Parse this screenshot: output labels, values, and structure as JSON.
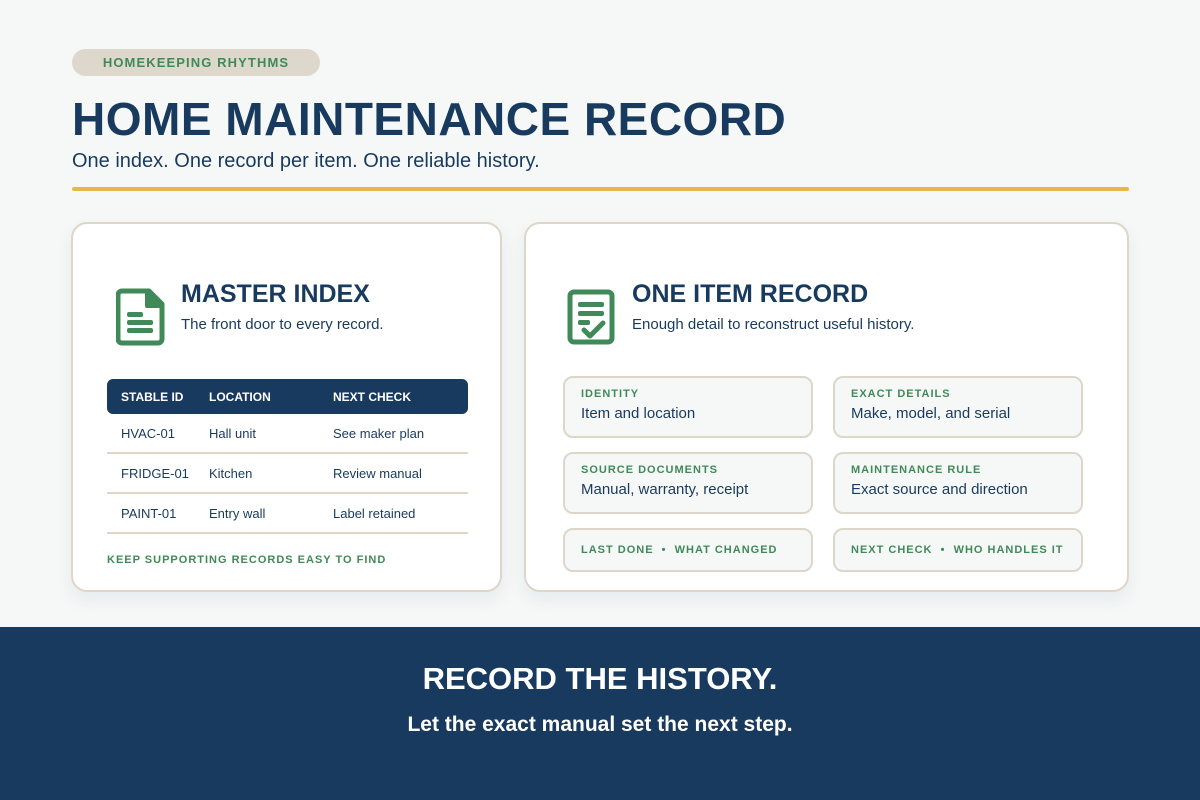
{
  "header": {
    "eyebrow": "HOMEKEEPING RHYTHMS",
    "title": "HOME MAINTENANCE RECORD",
    "subtitle": "One index. One record per item. One reliable history."
  },
  "master_index": {
    "icon": "document-icon",
    "title": "MASTER INDEX",
    "subtitle": "The front door to every record.",
    "columns": [
      "STABLE ID",
      "LOCATION",
      "NEXT CHECK"
    ],
    "rows": [
      [
        "HVAC-01",
        "Hall unit",
        "See maker plan"
      ],
      [
        "FRIDGE-01",
        "Kitchen",
        "Review manual"
      ],
      [
        "PAINT-01",
        "Entry wall",
        "Label retained"
      ]
    ],
    "footnote": "KEEP SUPPORTING RECORDS EASY TO FIND"
  },
  "item_record": {
    "icon": "checklist-icon",
    "title": "ONE ITEM RECORD",
    "subtitle": "Enough detail to reconstruct useful history.",
    "fields": [
      {
        "label": "IDENTITY",
        "value": "Item and location"
      },
      {
        "label": "EXACT DETAILS",
        "value": "Make, model, and serial"
      },
      {
        "label": "SOURCE DOCUMENTS",
        "value": "Manual, warranty, receipt"
      },
      {
        "label": "MAINTENANCE RULE",
        "value": "Exact source and direction"
      },
      {
        "label": "LAST DONE  •  WHAT CHANGED"
      },
      {
        "label": "NEXT CHECK  •  WHO HANDLES IT"
      }
    ]
  },
  "banner": {
    "title": "RECORD THE HISTORY.",
    "subtitle": "Let the exact manual set the next step."
  },
  "colors": {
    "navy": "#183a5f",
    "green": "#3f8a58",
    "gold": "#e6b84b",
    "beige": "#ddd8cb",
    "background": "#f6f8f7"
  }
}
